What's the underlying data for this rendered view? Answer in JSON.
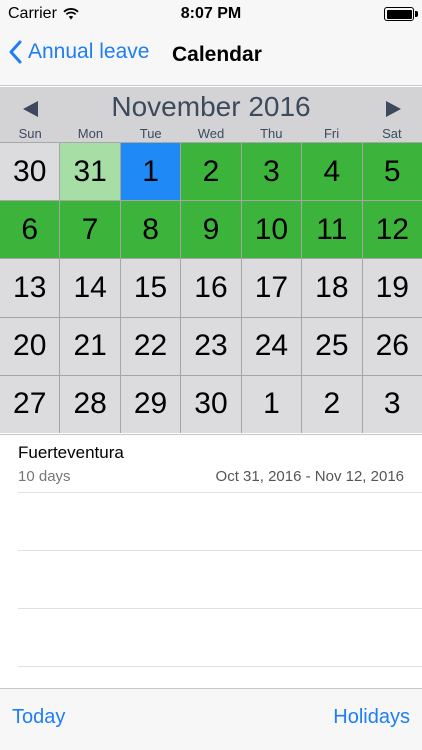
{
  "status_bar": {
    "carrier": "Carrier",
    "time": "8:07 PM"
  },
  "nav": {
    "back_label": "Annual leave",
    "title": "Calendar"
  },
  "calendar": {
    "month_title": "November 2016",
    "weekdays": [
      "Sun",
      "Mon",
      "Tue",
      "Wed",
      "Thu",
      "Fri",
      "Sat"
    ],
    "rows": [
      [
        "30",
        "31",
        "1",
        "2",
        "3",
        "4",
        "5"
      ],
      [
        "6",
        "7",
        "8",
        "9",
        "10",
        "11",
        "12"
      ],
      [
        "13",
        "14",
        "15",
        "16",
        "17",
        "18",
        "19"
      ],
      [
        "20",
        "21",
        "22",
        "23",
        "24",
        "25",
        "26"
      ],
      [
        "27",
        "28",
        "29",
        "30",
        "1",
        "2",
        "3"
      ]
    ],
    "colors": {
      "leave": "#3cb43c",
      "leave_light": "#a6dea6",
      "selected": "#1f8af5",
      "default": "#dcdcdf"
    }
  },
  "event": {
    "title": "Fuerteventura",
    "duration": "10 days",
    "range": "Oct 31, 2016 - Nov 12, 2016"
  },
  "toolbar": {
    "today_label": "Today",
    "holidays_label": "Holidays"
  },
  "accent_color": "#1f7ef5"
}
